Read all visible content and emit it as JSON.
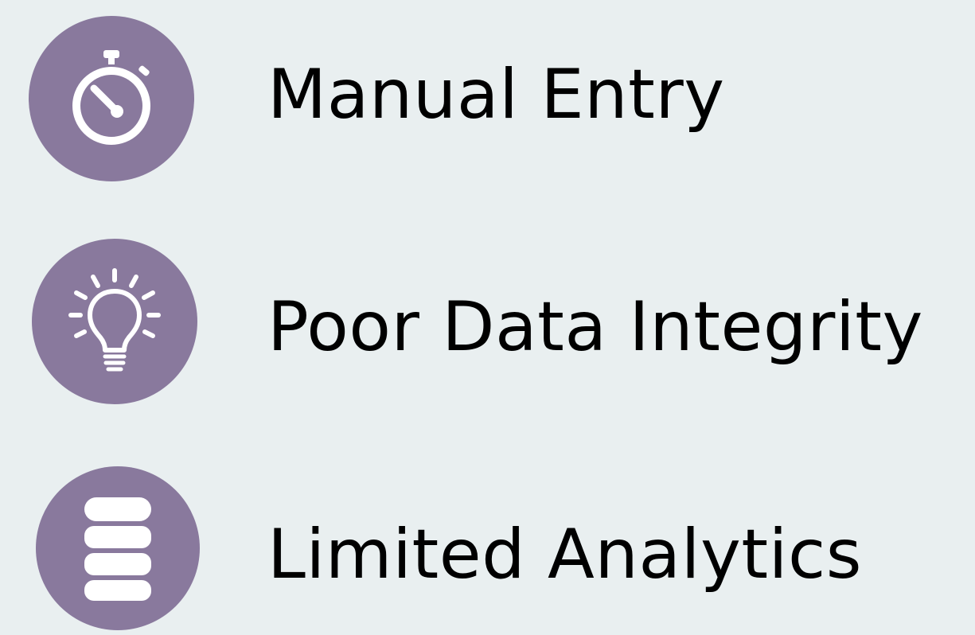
{
  "colors": {
    "background": "#e9eff0",
    "icon_circle": "#89799d",
    "icon_glyph": "#ffffff",
    "text": "#000000"
  },
  "items": [
    {
      "label": "Manual Entry",
      "icon": "stopwatch-icon"
    },
    {
      "label": "Poor Data Integrity",
      "icon": "lightbulb-icon"
    },
    {
      "label": "Limited Analytics",
      "icon": "database-icon"
    }
  ]
}
